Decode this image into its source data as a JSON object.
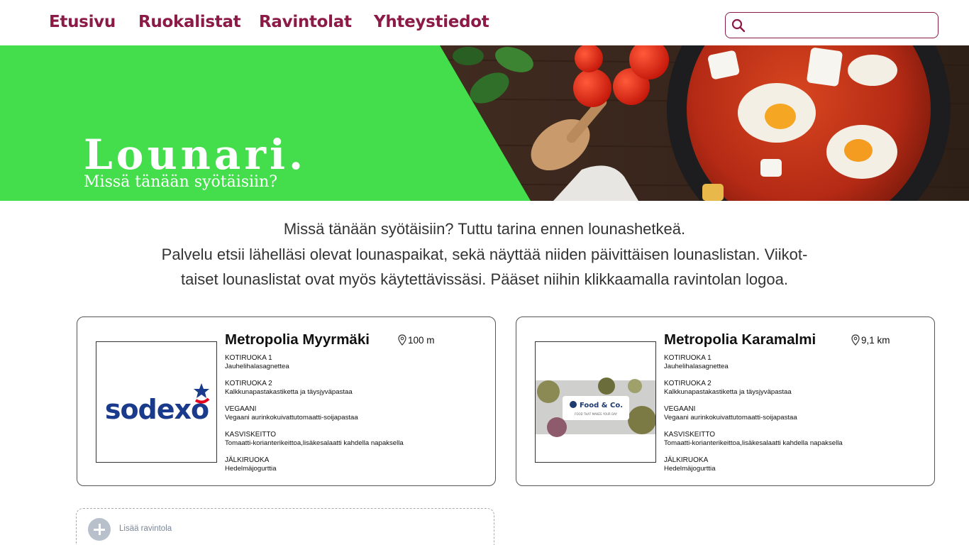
{
  "nav": {
    "items": [
      {
        "label": "Etusivu"
      },
      {
        "label": "Ruokalistat"
      },
      {
        "label": "Ravintolat"
      },
      {
        "label": "Yhteystiedot"
      }
    ],
    "search": {
      "placeholder": "",
      "value": "",
      "icon": "search-icon"
    }
  },
  "hero": {
    "title": "Lounari.",
    "subtitle": "Missä tänään syötäisiin?",
    "accent_color": "#44de4d"
  },
  "intro": {
    "line1": "Missä tänään syötäisiin? Tuttu tarina ennen lounashetkeä.",
    "line2": "Palvelu etsii lähelläsi olevat lounaspaikat, sekä näyttää niiden päivittäisen lounaslistan. Viikot-",
    "line3": "taiset lounaslistat ovat myös käytettävissäsi. Pääset niihin klikkaamalla ravintolan logoa."
  },
  "restaurants": [
    {
      "name": "Metropolia Myyrmäki",
      "distance": "100 m",
      "logo_text": "sodexo",
      "menu": [
        {
          "category": "KOTIRUOKA 1",
          "dish": "Jauhelihalasagnettea"
        },
        {
          "category": "KOTIRUOKA 2",
          "dish": "Kalkkunapastakastiketta ja täysjyväpastaa"
        },
        {
          "category": "VEGAANI",
          "dish": "Vegaani aurinkokuivattutomaatti-soijapastaa"
        },
        {
          "category": "KASVISKEITTO",
          "dish": "Tomaatti-korianterikeittoa,lisäkesalaatti kahdella napaksella"
        },
        {
          "category": "JÄLKIRUOKA",
          "dish": "Hedelmäjogurttia"
        }
      ]
    },
    {
      "name": "Metropolia Karamalmi",
      "distance": "9,1 km",
      "logo_text": "Food & Co.",
      "logo_tagline": "FOOD THAT MAKES YOUR DAY",
      "menu": [
        {
          "category": "KOTIRUOKA 1",
          "dish": "Jauhelihalasagnettea"
        },
        {
          "category": "KOTIRUOKA 2",
          "dish": "Kalkkunapastakastiketta ja täysjyväpastaa"
        },
        {
          "category": "VEGAANI",
          "dish": "Vegaani aurinkokuivattutomaatti-soijapastaa"
        },
        {
          "category": "KASVISKEITTO",
          "dish": "Tomaatti-korianterikeittoa,lisäkesalaatti kahdella napaksella"
        },
        {
          "category": "JÄLKIRUOKA",
          "dish": "Hedelmäjogurttia"
        }
      ]
    }
  ],
  "add_restaurant": {
    "label": "Lisää ravintola",
    "icon": "plus-icon"
  },
  "colors": {
    "brand": "#8c1a47",
    "hero_green": "#44de4d",
    "sodexo_blue": "#1a3a8c",
    "sodexo_red": "#e2001a"
  }
}
